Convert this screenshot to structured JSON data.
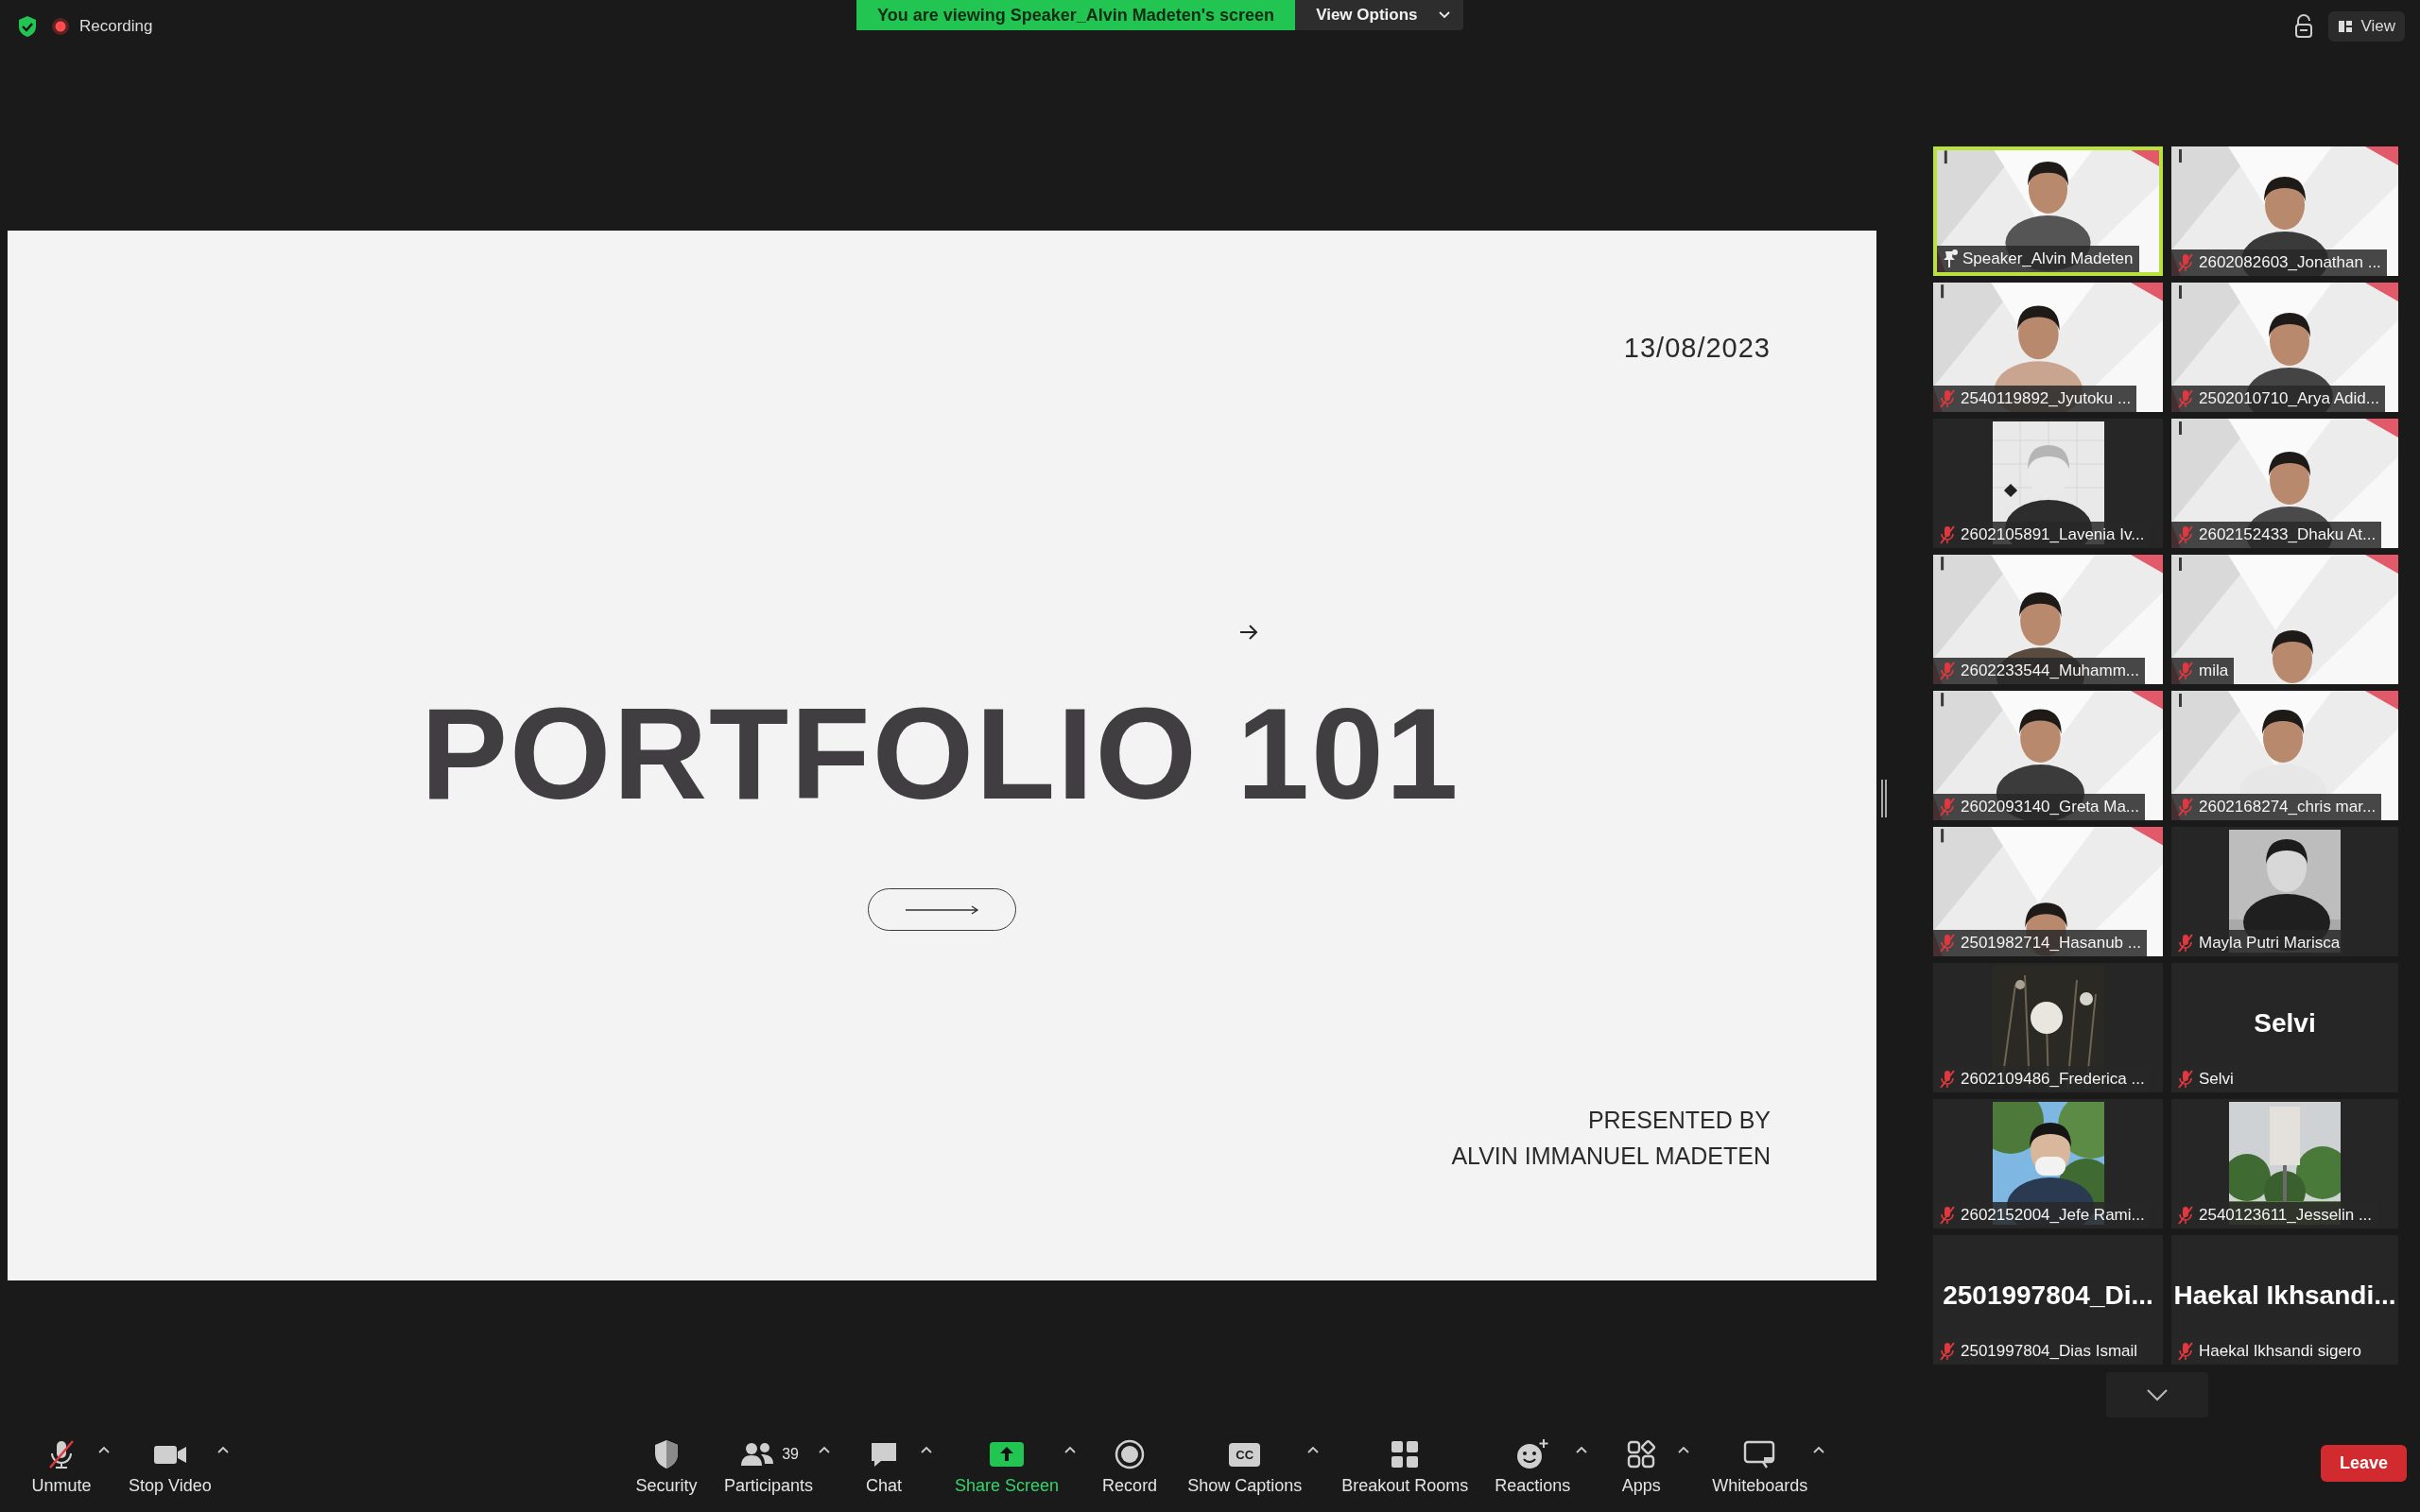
{
  "top_bar": {
    "recording": {
      "label": "Recording",
      "on": true
    },
    "banner": {
      "text": "You are viewing Speaker_Alvin Madeten's screen",
      "menu_label": "View Options"
    },
    "view_button": "View"
  },
  "slide": {
    "date": "13/08/2023",
    "title": "PORTFOLIO 101",
    "presented_by": [
      "PRESENTED BY",
      "ALVIN IMMANUEL MADETEN"
    ]
  },
  "participants": [
    {
      "name": "Speaker_Alvin Madeten",
      "kind": "video",
      "muted": false,
      "pinned": true,
      "speaking": true
    },
    {
      "name": "2602082603_Jonathan ...",
      "kind": "video",
      "muted": true,
      "pinned": false,
      "speaking": false
    },
    {
      "name": "2540119892_Jyutoku ...",
      "kind": "video",
      "muted": true,
      "pinned": false,
      "speaking": false
    },
    {
      "name": "2502010710_Arya Adid...",
      "kind": "video",
      "muted": true,
      "pinned": false,
      "speaking": false
    },
    {
      "name": "2602105891_Lavenia Iv...",
      "kind": "avatar",
      "muted": true,
      "pinned": false,
      "speaking": false
    },
    {
      "name": "2602152433_Dhaku At...",
      "kind": "video",
      "muted": true,
      "pinned": false,
      "speaking": false
    },
    {
      "name": "2602233544_Muhamm...",
      "kind": "video",
      "muted": true,
      "pinned": false,
      "speaking": false
    },
    {
      "name": "mila",
      "kind": "video",
      "muted": true,
      "pinned": false,
      "speaking": false
    },
    {
      "name": "2602093140_Greta Ma...",
      "kind": "video",
      "muted": true,
      "pinned": false,
      "speaking": false
    },
    {
      "name": "2602168274_chris mar...",
      "kind": "video",
      "muted": true,
      "pinned": false,
      "speaking": false
    },
    {
      "name": "2501982714_Hasanub ...",
      "kind": "video",
      "muted": true,
      "pinned": false,
      "speaking": false
    },
    {
      "name": "Mayla Putri Marisca",
      "kind": "avatar",
      "muted": true,
      "pinned": false,
      "speaking": false
    },
    {
      "name": "2602109486_Frederica ...",
      "kind": "avatar",
      "muted": true,
      "pinned": false,
      "speaking": false
    },
    {
      "name": "Selvi",
      "kind": "name",
      "display_name": "Selvi",
      "muted": true,
      "pinned": false,
      "speaking": false
    },
    {
      "name": "2602152004_Jefe Rami...",
      "kind": "avatar",
      "muted": true,
      "pinned": false,
      "speaking": false
    },
    {
      "name": "2540123611_Jesselin ...",
      "kind": "avatar",
      "muted": true,
      "pinned": false,
      "speaking": false
    },
    {
      "name": "2501997804_Dias Ismail",
      "kind": "name",
      "display_name": "2501997804_Di...",
      "muted": true,
      "pinned": false,
      "speaking": false
    },
    {
      "name": "Haekal Ikhsandi sigero",
      "kind": "name",
      "display_name": "Haekal  Ikhsandi...",
      "muted": true,
      "pinned": false,
      "speaking": false
    }
  ],
  "toolbar": {
    "left": [
      {
        "kind": "unmute",
        "label": "Unmute",
        "menu": true
      },
      {
        "kind": "video",
        "label": "Stop Video",
        "menu": true
      }
    ],
    "center": [
      {
        "kind": "security",
        "label": "Security",
        "menu": false
      },
      {
        "kind": "participants",
        "label": "Participants",
        "count": "39",
        "menu": true
      },
      {
        "kind": "chat",
        "label": "Chat",
        "menu": true
      },
      {
        "kind": "share",
        "label": "Share Screen",
        "menu": true
      },
      {
        "kind": "record",
        "label": "Record",
        "menu": false
      },
      {
        "kind": "captions",
        "label": "Show Captions",
        "icon_text": "CC",
        "menu": true
      },
      {
        "kind": "breakout",
        "label": "Breakout Rooms",
        "menu": false
      },
      {
        "kind": "reactions",
        "label": "Reactions",
        "menu": true
      },
      {
        "kind": "apps",
        "label": "Apps",
        "menu": true
      },
      {
        "kind": "whiteboard",
        "label": "Whiteboards",
        "menu": true
      }
    ],
    "leave": "Leave"
  }
}
